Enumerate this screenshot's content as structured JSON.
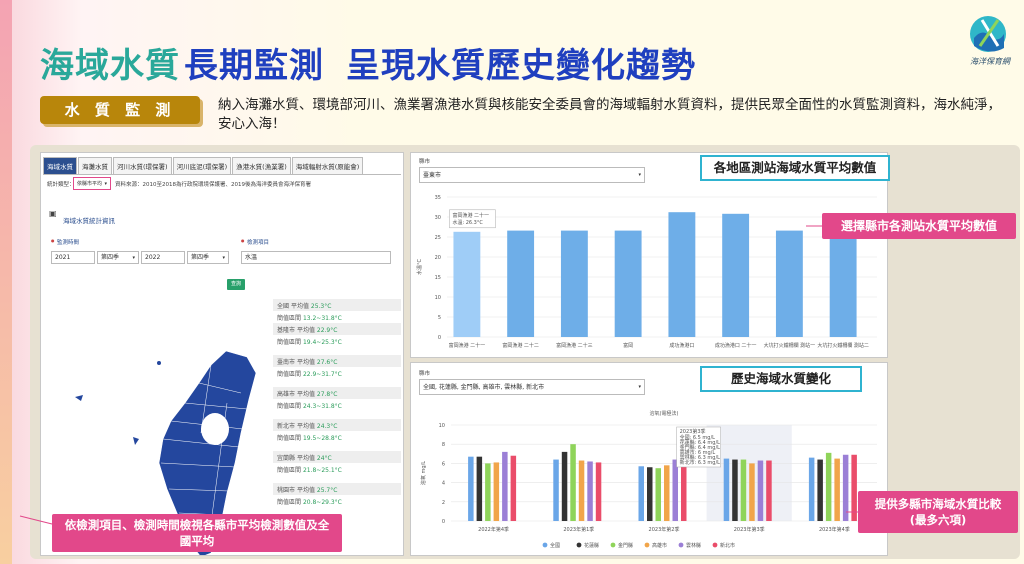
{
  "header": {
    "title_part1": "海域水質",
    "title_part2": "長期監測",
    "title_part3": "呈現水質歷史變化趨勢",
    "logo_text": "海洋保育網"
  },
  "section": {
    "badge": "水 質 監 測",
    "description": "納入海灘水質、環境部河川、漁業署漁港水質與核能安全委員會的海域輻射水質資料，提供民眾全面性的水質監測資料，海水純淨，安心入海！"
  },
  "left_panel": {
    "tabs": [
      "海域水質",
      "海灘水質",
      "河川水質(環保署)",
      "河川底泥(環保署)",
      "漁港水質(漁業署)",
      "海域輻射水質(原能會)"
    ],
    "stats_type_label": "統計類型：",
    "stats_type_value": "依縣市平均",
    "source_text": "資料來源：2010至2018為行政院環境保護署、2019後為海洋委員會海洋保育署",
    "info_title": "海域水質統計資訊",
    "time_label": "監測時間",
    "item_label": "檢測項目",
    "year_from": "2021",
    "quarter_from": "第四季",
    "year_to": "2022",
    "quarter_to": "第四季",
    "item_value": "水溫",
    "query_button": "查詢",
    "stats": [
      {
        "name": "全國",
        "avg": "25.3°C",
        "range": "13.2~31.8°C"
      },
      {
        "name": "基隆市",
        "avg": "22.9°C",
        "range": "19.4~25.3°C"
      },
      {
        "name": "臺南市",
        "avg": "27.6°C",
        "range": "22.9~31.7°C"
      },
      {
        "name": "高雄市",
        "avg": "27.8°C",
        "range": "24.3~31.8°C"
      },
      {
        "name": "新北市",
        "avg": "24.3°C",
        "range": "19.5~28.8°C"
      },
      {
        "name": "宜蘭縣",
        "avg": "24°C",
        "range": "21.8~25.1°C"
      },
      {
        "name": "桃園市",
        "avg": "25.7°C",
        "range": "20.8~29.3°C"
      }
    ],
    "avg_label": "平均值",
    "range_label": "簡值區間"
  },
  "callouts": {
    "station_avg": "各地區測站海域水質平均數值",
    "select_county": "選擇縣市各測站水質平均數值",
    "history": "歷史海域水質變化",
    "compare": "提供多縣市海域水質比較\n(最多六項)",
    "left_bottom": "依檢測項目、檢測時間檢視各縣市平均檢測數值及全國平均"
  },
  "top_chart": {
    "county_label": "縣市",
    "county_value": "臺東市",
    "tooltip_line1": "富岡漁港 二十一",
    "tooltip_line2": "水溫: 26.3°C",
    "ylabel": "水溫°C"
  },
  "bottom_chart": {
    "county_label": "縣市",
    "county_value": "全國, 花蓮縣, 金門縣, 高雄市, 雲林縣, 新北市",
    "title": "溶氧(電極法)",
    "ylabel": "溶氧 mg/L",
    "tooltip_title": "2023第3季",
    "tooltip_lines": [
      "全國: 6.5 mg/L",
      "花蓮縣: 6.4 mg/L",
      "金門縣: 6.4 mg/L",
      "高雄市: 6 mg/L",
      "雲林縣: 6.3 mg/L",
      "新北市: 6.3 mg/L"
    ]
  },
  "chart_data": [
    {
      "type": "bar",
      "categories": [
        "富岡漁港 二十一",
        "富岡漁港 二十二",
        "富岡漁港 二十三",
        "富岡",
        "成功漁港口",
        "成功漁港口 二十一",
        "大坑打火鐵柵欄 測站一",
        "大坑打火鐵柵欄 測站二"
      ],
      "values": [
        26.3,
        26.6,
        26.6,
        26.6,
        31.2,
        30.8,
        26.6,
        26.6
      ],
      "ylabel": "水溫°C",
      "ylim": [
        0,
        35
      ],
      "yticks": [
        0,
        5,
        10,
        15,
        20,
        25,
        30,
        35
      ]
    },
    {
      "type": "bar",
      "title": "溶氧(電極法)",
      "categories": [
        "2022年第4季",
        "2023年第1季",
        "2023年第2季",
        "2023年第3季",
        "2023年第4季"
      ],
      "series": [
        {
          "name": "全國",
          "color": "#6aa6e8",
          "values": [
            6.7,
            6.4,
            5.7,
            6.5,
            6.6
          ]
        },
        {
          "name": "花蓮縣",
          "color": "#333333",
          "values": [
            6.7,
            7.2,
            5.6,
            6.4,
            6.4
          ]
        },
        {
          "name": "金門縣",
          "color": "#8fd45a",
          "values": [
            6.0,
            8.0,
            5.5,
            6.4,
            7.1
          ]
        },
        {
          "name": "高雄市",
          "color": "#f1a54a",
          "values": [
            6.1,
            6.3,
            5.8,
            6.0,
            6.5
          ]
        },
        {
          "name": "雲林縣",
          "color": "#9b7fd6",
          "values": [
            7.2,
            6.2,
            6.4,
            6.3,
            6.9
          ]
        },
        {
          "name": "新北市",
          "color": "#ea4d6a",
          "values": [
            6.8,
            6.1,
            5.9,
            6.3,
            6.9
          ]
        }
      ],
      "ylabel": "溶氧 mg/L",
      "ylim": [
        0,
        10
      ],
      "yticks": [
        0,
        2,
        4,
        6,
        8,
        10
      ],
      "legend": "bottom"
    }
  ]
}
